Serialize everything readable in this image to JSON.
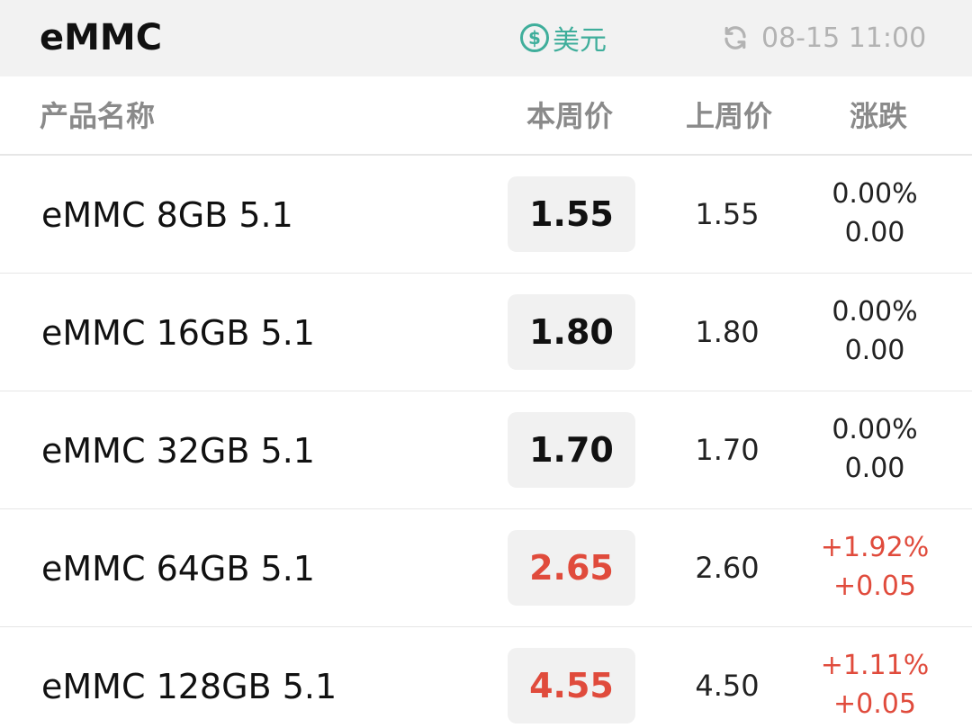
{
  "header": {
    "title": "eMMC",
    "currency_symbol": "$",
    "currency_label": "美元",
    "timestamp": "08-15 11:00"
  },
  "columns": {
    "name": "产品名称",
    "this_week": "本周价",
    "last_week": "上周价",
    "change": "涨跌"
  },
  "colors": {
    "accent_currency": "#3fae9b",
    "up": "#e04b3c",
    "neutral": "#111111",
    "muted": "#b3b3b3"
  },
  "icons": {
    "currency": "dollar-circle-icon",
    "refresh": "refresh-icon"
  },
  "rows": [
    {
      "name": "eMMC 8GB 5.1",
      "this_week": "1.55",
      "last_week": "1.55",
      "pct": "0.00%",
      "delta": "0.00",
      "trend": "flat"
    },
    {
      "name": "eMMC 16GB 5.1",
      "this_week": "1.80",
      "last_week": "1.80",
      "pct": "0.00%",
      "delta": "0.00",
      "trend": "flat"
    },
    {
      "name": "eMMC 32GB 5.1",
      "this_week": "1.70",
      "last_week": "1.70",
      "pct": "0.00%",
      "delta": "0.00",
      "trend": "flat"
    },
    {
      "name": "eMMC 64GB 5.1",
      "this_week": "2.65",
      "last_week": "2.60",
      "pct": "+1.92%",
      "delta": "+0.05",
      "trend": "up"
    },
    {
      "name": "eMMC 128GB 5.1",
      "this_week": "4.55",
      "last_week": "4.50",
      "pct": "+1.11%",
      "delta": "+0.05",
      "trend": "up"
    }
  ]
}
